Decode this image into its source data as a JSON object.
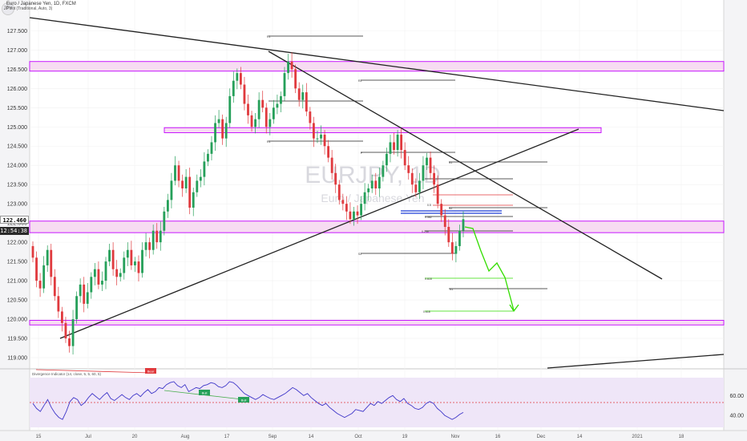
{
  "header": {
    "symbol_line": "Euro / Japanese Yen, 1D, FXCM",
    "indicator_line": "Pivot (Traditional, Auto, 3)",
    "currency": "JPY"
  },
  "watermark": {
    "symbol": "EURJPY, 1D",
    "name": "Euro / Japanese Yen"
  },
  "price_tags": {
    "last_price": "122.460",
    "countdown": "12:54:38"
  },
  "oscillator": {
    "title": "Divergence Indicator (14, close, 5, 5, 60, 5)",
    "bear_badge": "Bear",
    "bull_badges": [
      "Bull",
      "Bull"
    ]
  },
  "chart_data": [
    {
      "type": "candlestick",
      "title": "",
      "y_ticks": [
        119.0,
        119.5,
        120.0,
        120.5,
        121.0,
        121.5,
        122.0,
        122.5,
        123.0,
        123.5,
        124.0,
        124.5,
        125.0,
        125.5,
        126.0,
        126.5,
        127.0,
        127.5
      ],
      "y_tick_labels": [
        "119.000",
        "119.500",
        "120.000",
        "120.500",
        "121.000",
        "121.500",
        "122.000",
        "122.500",
        "123.000",
        "123.500",
        "124.000",
        "124.500",
        "125.000",
        "125.500",
        "126.000",
        "126.500",
        "127.000",
        "127.500"
      ],
      "ylim": [
        118.75,
        128.3
      ],
      "x_tick_labels": [
        "15",
        "Jul",
        "20",
        "Aug",
        "17",
        "Sep",
        "14",
        "Oct",
        "19",
        "Nov",
        "16",
        "Dec",
        "14",
        "2021",
        "18"
      ],
      "close": [
        121.6,
        121.0,
        120.8,
        121.4,
        121.8,
        121.1,
        120.6,
        120.2,
        119.9,
        119.5,
        119.3,
        120.0,
        120.6,
        120.9,
        120.4,
        120.7,
        121.1,
        121.3,
        120.9,
        121.0,
        121.5,
        121.8,
        121.3,
        121.1,
        121.2,
        121.6,
        121.8,
        121.4,
        121.5,
        121.2,
        121.8,
        122.0,
        121.8,
        122.3,
        122.0,
        122.3,
        122.8,
        123.1,
        123.6,
        124.0,
        123.6,
        123.4,
        123.7,
        122.9,
        123.3,
        123.6,
        123.7,
        124.1,
        124.3,
        124.6,
        125.1,
        125.2,
        124.7,
        125.1,
        125.8,
        126.2,
        126.4,
        126.1,
        125.6,
        125.3,
        125.0,
        125.2,
        125.7,
        125.5,
        125.0,
        125.2,
        125.5,
        125.6,
        125.8,
        126.4,
        126.7,
        126.5,
        126.0,
        125.7,
        125.9,
        125.4,
        125.1,
        124.7,
        124.7,
        124.8,
        124.5,
        124.2,
        123.8,
        123.5,
        123.1,
        123.0,
        122.8,
        122.6,
        122.8,
        122.7,
        123.0,
        123.3,
        123.4,
        123.6,
        123.4,
        123.7,
        124.0,
        124.3,
        124.6,
        124.4,
        124.8,
        124.4,
        124.0,
        123.8,
        123.5,
        123.3,
        123.6,
        124.0,
        124.2,
        123.8,
        123.5,
        123.0,
        122.7,
        122.4,
        122.0,
        121.7,
        121.9,
        122.3,
        122.6
      ],
      "open": [
        121.9,
        121.6,
        121.0,
        120.8,
        121.4,
        121.8,
        121.1,
        120.6,
        120.2,
        119.9,
        119.5,
        119.3,
        120.0,
        120.6,
        120.9,
        120.4,
        120.7,
        121.1,
        121.3,
        120.9,
        121.0,
        121.5,
        121.8,
        121.3,
        121.1,
        121.2,
        121.6,
        121.8,
        121.4,
        121.5,
        121.2,
        121.8,
        122.0,
        121.8,
        122.3,
        122.0,
        122.3,
        122.8,
        123.1,
        123.6,
        124.0,
        123.6,
        123.4,
        123.7,
        122.9,
        123.3,
        123.6,
        123.7,
        124.1,
        124.3,
        124.6,
        125.1,
        125.2,
        124.7,
        125.1,
        125.8,
        126.2,
        126.4,
        126.1,
        125.6,
        125.3,
        125.0,
        125.2,
        125.7,
        125.5,
        125.0,
        125.2,
        125.5,
        125.6,
        125.8,
        126.4,
        126.7,
        126.5,
        126.0,
        125.7,
        125.9,
        125.4,
        125.1,
        124.7,
        124.7,
        124.8,
        124.5,
        124.2,
        123.8,
        123.5,
        123.1,
        123.0,
        122.8,
        122.6,
        122.8,
        122.7,
        123.0,
        123.3,
        123.4,
        123.6,
        123.4,
        123.7,
        124.0,
        124.3,
        124.6,
        124.4,
        124.8,
        124.4,
        124.0,
        123.8,
        123.5,
        123.3,
        123.6,
        124.0,
        124.2,
        123.8,
        123.5,
        123.0,
        122.7,
        122.4,
        122.0,
        121.7,
        121.9,
        122.3
      ],
      "horizontal_zones": [
        {
          "low": 126.45,
          "high": 126.7,
          "color": "#c200ff"
        },
        {
          "low": 124.85,
          "high": 124.98,
          "color": "#c200ff"
        },
        {
          "low": 122.25,
          "high": 122.55,
          "color": "#c200ff"
        },
        {
          "low": 119.85,
          "high": 119.97,
          "color": "#c200ff"
        }
      ],
      "pivot_labels": [
        "R1",
        "R2",
        "P",
        "R1",
        "S1",
        "S2",
        "0.5",
        "0.382",
        "0.236",
        "0.618",
        "S1",
        "S2",
        "0.618"
      ],
      "projection_color": "#33dd00",
      "up_color": "#26a05a",
      "down_color": "#e03a3e"
    },
    {
      "type": "line",
      "title": "Divergence Indicator (14, close, 5, 5, 60, 5)",
      "y_ticks": [
        40.0,
        60.0
      ],
      "y_tick_labels": [
        "40.00",
        "60.00"
      ],
      "ylim": [
        28,
        78
      ],
      "reference_lines": [
        30,
        50,
        70
      ],
      "series": [
        {
          "values": [
            52,
            47,
            44,
            50,
            56,
            48,
            42,
            38,
            36,
            44,
            54,
            58,
            56,
            50,
            53,
            58,
            62,
            59,
            56,
            60,
            63,
            57,
            55,
            58,
            61,
            58,
            56,
            60,
            62,
            59,
            63,
            66,
            62,
            64,
            68,
            67,
            71,
            73,
            74,
            70,
            68,
            71,
            64,
            66,
            68,
            67,
            70,
            71,
            73,
            72,
            69,
            68,
            70,
            74,
            73,
            70,
            66,
            62,
            60,
            58,
            56,
            58,
            61,
            59,
            57,
            56,
            58,
            60,
            62,
            65,
            68,
            66,
            63,
            60,
            62,
            58,
            55,
            52,
            50,
            52,
            48,
            45,
            42,
            40,
            38,
            40,
            42,
            46,
            45,
            44,
            48,
            52,
            50,
            54,
            52,
            55,
            58,
            60,
            56,
            54,
            57,
            52,
            50,
            47,
            46,
            48,
            52,
            54,
            52,
            47,
            44,
            40,
            38,
            36,
            38,
            41,
            43
          ]
        }
      ]
    }
  ]
}
